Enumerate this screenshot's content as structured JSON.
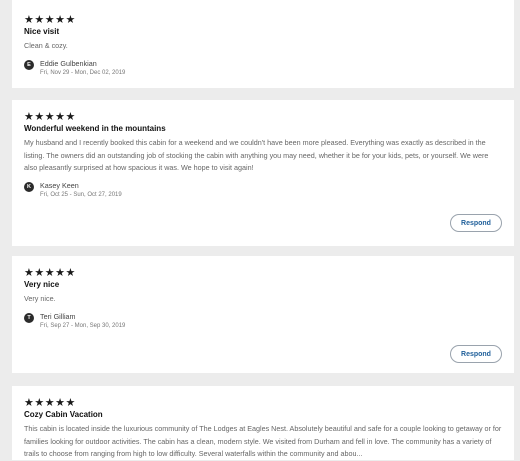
{
  "reviews": [
    {
      "stars": "★★★★★",
      "rating": 5,
      "title": "Nice visit",
      "text": "Clean & cozy.",
      "avatar_initial": "E",
      "author": "Eddie Gulbenkian",
      "dates": "Fri, Nov 29 - Mon, Dec 02, 2019"
    },
    {
      "stars": "★★★★★",
      "rating": 5,
      "title": "Wonderful weekend in the mountains",
      "text": "My husband and I recently booked this cabin for a weekend and we couldn't have been more pleased. Everything was exactly as described in the listing. The owners did an outstanding job of stocking the cabin with anything you may need, whether it be for your kids, pets, or yourself. We were also pleasantly surprised at how spacious it was. We hope to visit again!",
      "avatar_initial": "K",
      "author": "Kasey Keen",
      "dates": "Fri, Oct 25 - Sun, Oct 27, 2019",
      "respond_label": "Respond"
    },
    {
      "stars": "★★★★★",
      "rating": 5,
      "title": "Very nice",
      "text": "Very nice.",
      "avatar_initial": "T",
      "author": "Teri Gilliam",
      "dates": "Fri, Sep 27 - Mon, Sep 30, 2019",
      "respond_label": "Respond"
    },
    {
      "stars": "★★★★★",
      "rating": 5,
      "title": "Cozy Cabin Vacation",
      "text": "This cabin is located inside the luxurious community of The Lodges at Eagles Nest. Absolutely beautiful and safe for a couple looking to getaway or for families looking for outdoor activities. The cabin has a clean, modern style. We visited from Durham and fell in love. The community has a variety of trails to choose from ranging from high to low difficulty. Several waterfalls within the community and abou..."
    }
  ]
}
